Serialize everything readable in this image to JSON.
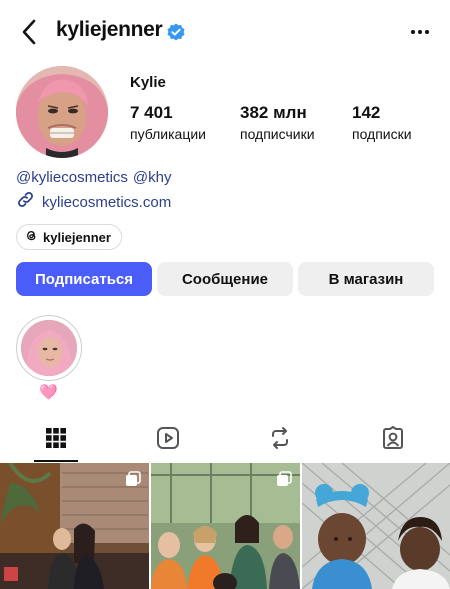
{
  "header": {
    "username": "kyliejenner",
    "verified_color": "#3897f0",
    "back_icon": "chevron-left-icon",
    "more_icon": "more-horizontal-icon"
  },
  "profile": {
    "display_name": "Kylie",
    "stats": [
      {
        "value": "7 401",
        "label": "публикации"
      },
      {
        "value": "382 млн",
        "label": "подписчики"
      },
      {
        "value": "142",
        "label": "подписки"
      }
    ],
    "bio_tags": [
      "@kyliecosmetics",
      "@khy"
    ],
    "link": "kyliecosmetics.com",
    "threads_handle": "kyliejenner",
    "link_color": "#2b3f8c"
  },
  "actions": {
    "follow": "Подписаться",
    "message": "Сообщение",
    "shop": "В магазин",
    "accent": "#4a5df9"
  },
  "highlights": [
    {
      "label": "🩷"
    }
  ],
  "tabs": [
    {
      "icon": "grid-icon",
      "active": true
    },
    {
      "icon": "reels-icon",
      "active": false
    },
    {
      "icon": "reposts-icon",
      "active": false
    },
    {
      "icon": "tagged-icon",
      "active": false
    }
  ]
}
